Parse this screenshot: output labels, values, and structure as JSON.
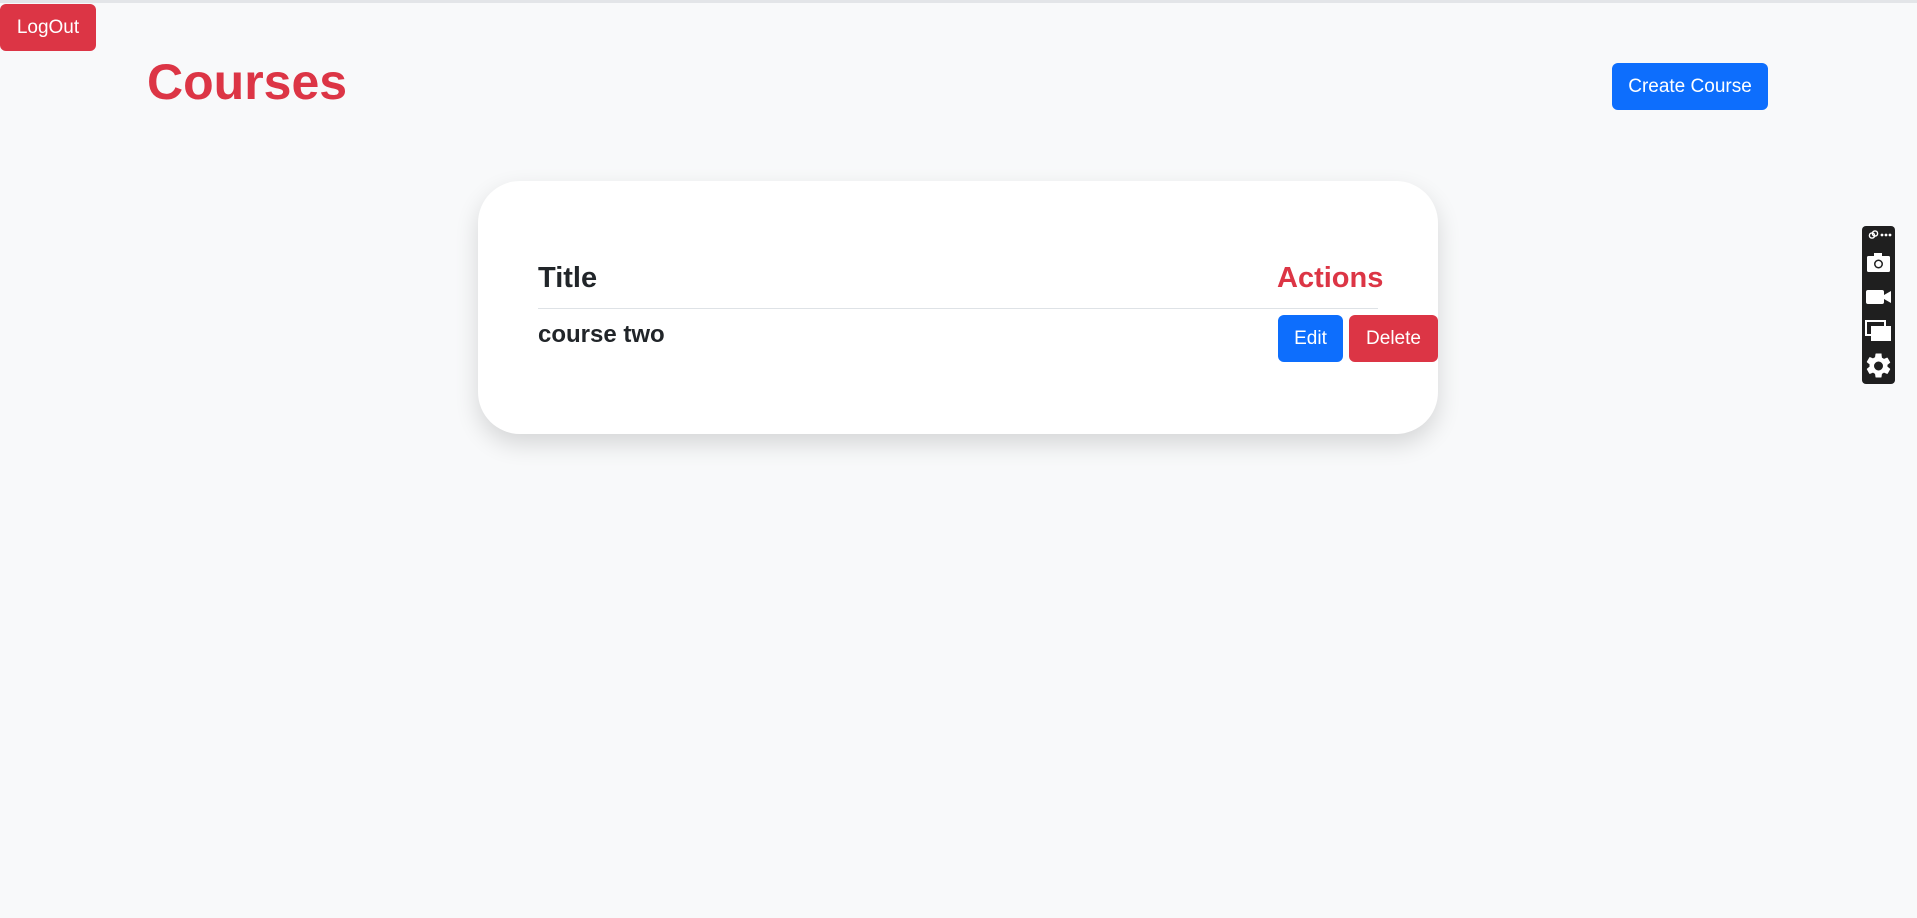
{
  "header": {
    "logout_label": "LogOut",
    "page_title": "Courses",
    "create_label": "Create Course"
  },
  "table": {
    "columns": [
      "Title",
      "Actions"
    ],
    "rows": [
      {
        "title": "course two",
        "edit_label": "Edit",
        "delete_label": "Delete"
      }
    ]
  },
  "toolbar": {
    "icons": [
      "link-icon",
      "more-icon",
      "camera-icon",
      "video-camera-icon",
      "windows-icon",
      "gear-icon"
    ]
  },
  "colors": {
    "primary": "#0d6efd",
    "danger": "#dc3545",
    "background": "#f8f9fa",
    "card": "#ffffff",
    "toolbar": "#1f1f1f"
  }
}
